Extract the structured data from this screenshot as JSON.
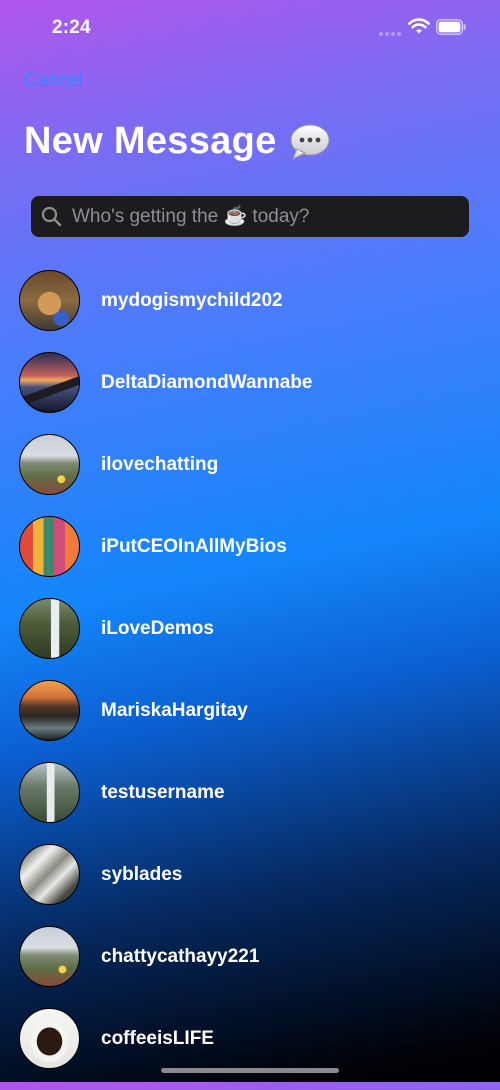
{
  "status_bar": {
    "time": "2:24",
    "icons": [
      "cellular-signal-icon",
      "wifi-icon",
      "battery-icon"
    ]
  },
  "header": {
    "cancel_label": "Cancel",
    "title": "New Message",
    "title_icon": "speech-bubble-icon"
  },
  "search": {
    "placeholder": "Who's getting the ☕ today?",
    "value": ""
  },
  "contacts": [
    {
      "username": "mydogismychild202",
      "avatar": "dog-photo"
    },
    {
      "username": "DeltaDiamondWannabe",
      "avatar": "airplane-wing-sunset-photo"
    },
    {
      "username": "ilovechatting",
      "avatar": "coastal-hillside-photo"
    },
    {
      "username": "iPutCEOInAllMyBios",
      "avatar": "colorful-houses-canal-photo"
    },
    {
      "username": "iLoveDemos",
      "avatar": "waterfall-cliff-photo"
    },
    {
      "username": "MariskaHargitay",
      "avatar": "mountain-waterfall-sunset-photo"
    },
    {
      "username": "testusername",
      "avatar": "misty-waterfall-photo"
    },
    {
      "username": "syblades",
      "avatar": "rocky-cascade-photo"
    },
    {
      "username": "chattycathayy221",
      "avatar": "coastal-hillside-photo"
    },
    {
      "username": "coffeeisLIFE",
      "avatar": "coffee-cup-photo"
    }
  ],
  "colors": {
    "accent": "#3b82ff",
    "search_bg": "#1c1c1e",
    "placeholder": "#8e8e93"
  }
}
